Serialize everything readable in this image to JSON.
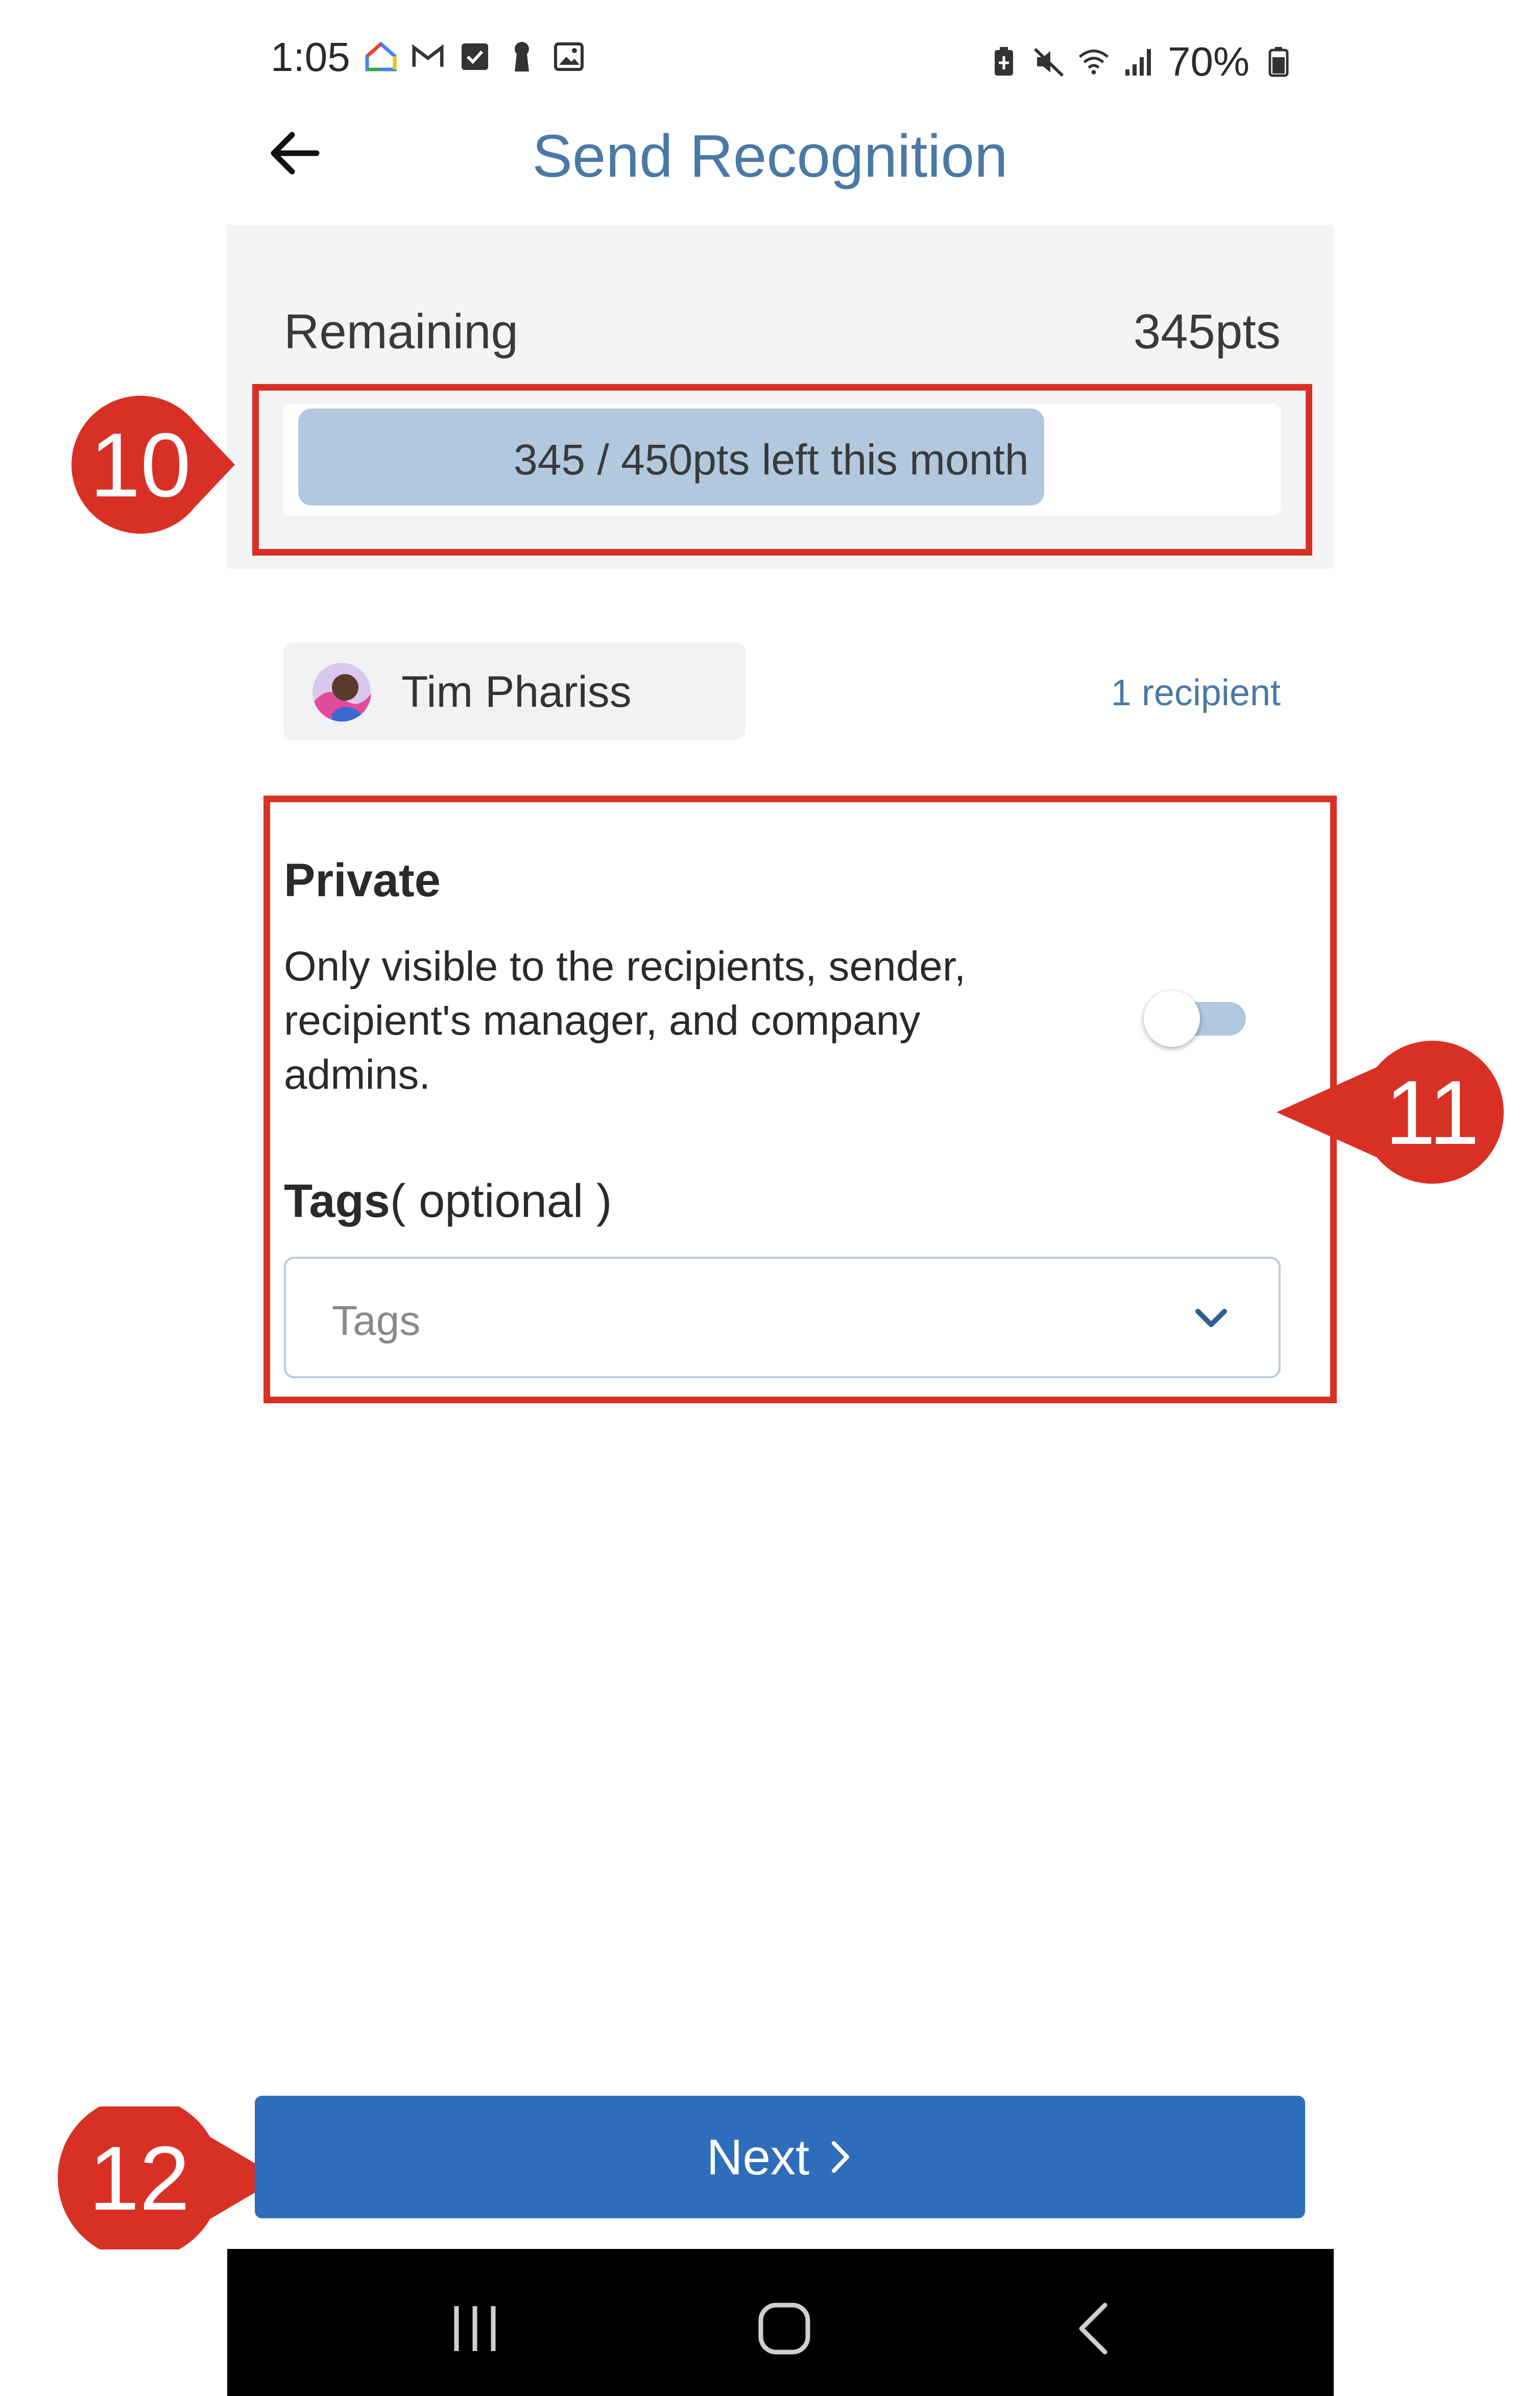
{
  "status_bar": {
    "time": "1:05",
    "battery": "70%",
    "left_icons": [
      "google-home-icon",
      "gmail-icon",
      "checkbox-icon",
      "keyhole-icon",
      "gallery-icon"
    ],
    "right_icons": [
      "battery-saver-icon",
      "mute-icon",
      "wifi-icon",
      "signal-icon",
      "battery-icon"
    ]
  },
  "header": {
    "title": "Send Recognition",
    "back_icon": "arrow-left-icon"
  },
  "points": {
    "remaining_label": "Remaining",
    "remaining_value": "345pts",
    "progress_text": "345 / 450pts left this month",
    "progress_fraction": 0.7667
  },
  "recipients": {
    "chip_name": "Tim Phariss",
    "count_label": "1 recipient"
  },
  "privacy": {
    "heading": "Private",
    "description": "Only visible to the recipients, sender, recipient's manager, and company admins.",
    "toggle_on": false
  },
  "tags": {
    "heading_bold": "Tags",
    "heading_rest": "( optional )",
    "placeholder": "Tags"
  },
  "next_button": {
    "label": "Next"
  },
  "annotations": {
    "marker_10": "10",
    "marker_11": "11",
    "marker_12": "12"
  },
  "colors": {
    "accent": "#2e6db9",
    "title": "#4a79a6",
    "progress_fill": "#b1c8de",
    "annotation": "#d93025"
  }
}
